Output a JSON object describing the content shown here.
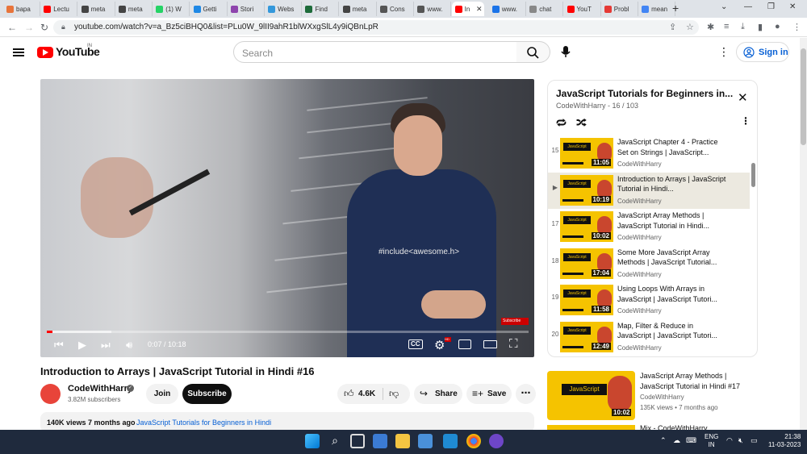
{
  "browser": {
    "tabs": [
      {
        "label": "bapa",
        "color": "#e8743b"
      },
      {
        "label": "Lectu",
        "color": "#ff0000"
      },
      {
        "label": "meta",
        "color": "#444444"
      },
      {
        "label": "meta",
        "color": "#444444"
      },
      {
        "label": "(1) W",
        "color": "#25d366"
      },
      {
        "label": "Getti",
        "color": "#1e88e5"
      },
      {
        "label": "Stori",
        "color": "#8e44ad"
      },
      {
        "label": "Webs",
        "color": "#3498db"
      },
      {
        "label": "Find",
        "color": "#1d6b3a"
      },
      {
        "label": "meta",
        "color": "#444444"
      },
      {
        "label": "Cons",
        "color": "#555555"
      },
      {
        "label": "www.",
        "color": "#555555"
      },
      {
        "label": "In",
        "color": "#ff0000"
      },
      {
        "label": "www.",
        "color": "#1a73e8"
      },
      {
        "label": "chat",
        "color": "#888888"
      },
      {
        "label": "YouT",
        "color": "#ff0000"
      },
      {
        "label": "Probl",
        "color": "#e53935"
      },
      {
        "label": "mean",
        "color": "#4285f4"
      }
    ],
    "active_tab_index": 12,
    "url": "youtube.com/watch?v=a_Bz5ciBHQ0&list=PLu0W_9lII9ahR1blWXxgSlL4y9iQBnLpR"
  },
  "header": {
    "logo_text": "YouTube",
    "logo_country": "IN",
    "search_placeholder": "Search",
    "signin_label": "Sign in"
  },
  "player": {
    "shirt_text": "#include<awesome.h>",
    "subscribe_badge": "Subscribe",
    "time": "0:07 / 10:18",
    "progress": 0.011,
    "hd_badge": "HD"
  },
  "video": {
    "title": "Introduction to Arrays | JavaScript Tutorial in Hindi #16",
    "channel": "CodeWithHarry",
    "subscribers": "3.82M subscribers",
    "join_label": "Join",
    "subscribe_label": "Subscribe",
    "likes": "4.6K",
    "share_label": "Share",
    "save_label": "Save",
    "views": "140K views  7 months ago",
    "playlist_link": "JavaScript Tutorials for Beginners in Hindi"
  },
  "playlist": {
    "title": "JavaScript Tutorials for Beginners in...",
    "subtitle": "CodeWithHarry - 16 / 103",
    "items": [
      {
        "index": "15",
        "title": "JavaScript Chapter 4 - Practice Set on Strings | JavaScript...",
        "channel": "CodeWithHarry",
        "duration": "11:05",
        "active": false
      },
      {
        "index": "▶",
        "title": "Introduction to Arrays | JavaScript Tutorial in Hindi...",
        "channel": "CodeWithHarry",
        "duration": "10:19",
        "active": true
      },
      {
        "index": "17",
        "title": "JavaScript Array Methods | JavaScript Tutorial in Hindi...",
        "channel": "CodeWithHarry",
        "duration": "10:02",
        "active": false
      },
      {
        "index": "18",
        "title": "Some More JavaScript Array Methods | JavaScript Tutorial...",
        "channel": "CodeWithHarry",
        "duration": "17:04",
        "active": false
      },
      {
        "index": "19",
        "title": "Using Loops With Arrays in JavaScript | JavaScript Tutori...",
        "channel": "CodeWithHarry",
        "duration": "11:58",
        "active": false
      },
      {
        "index": "20",
        "title": "Map, Filter & Reduce in JavaScript | JavaScript Tutori...",
        "channel": "CodeWithHarry",
        "duration": "12:49",
        "active": false
      }
    ],
    "thumb_badge": "JavaScript"
  },
  "related": {
    "title": "JavaScript Array Methods | JavaScript Tutorial in Hindi #17",
    "channel": "CodeWithHarry",
    "meta": "135K views • 7 months ago",
    "duration": "10:02",
    "thumb_badge": "JavaScript",
    "next_title": "Mix - CodeWithHarry"
  },
  "taskbar": {
    "lang": "ENG",
    "region": "IN",
    "time": "21:38",
    "date": "11-03-2023"
  }
}
